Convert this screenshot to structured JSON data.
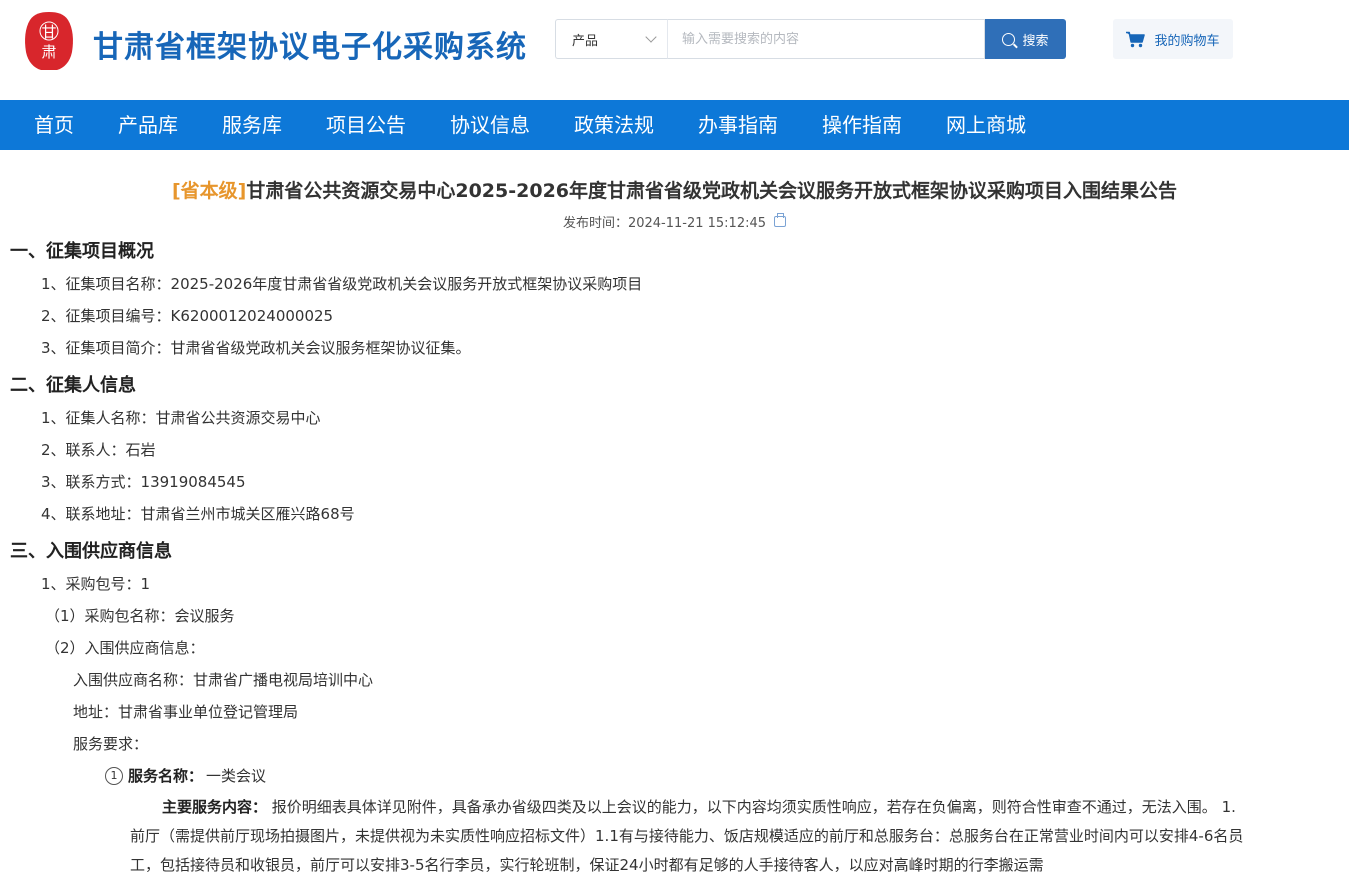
{
  "header": {
    "logo_text": "甘肃",
    "site_title": "甘肃省框架协议电子化采购系统",
    "search": {
      "category": "产品",
      "placeholder": "输入需要搜索的内容",
      "button_label": "搜索"
    },
    "cart_label": "我的购物车",
    "colors": {
      "title": "#1766b8",
      "nav": "#0d78d8",
      "logo": "#d8262c",
      "level_tag": "#e7962d"
    }
  },
  "nav": {
    "items": [
      "首页",
      "产品库",
      "服务库",
      "项目公告",
      "协议信息",
      "政策法规",
      "办事指南",
      "操作指南",
      "网上商城"
    ]
  },
  "article": {
    "level_tag": "[省本级]",
    "title": "甘肃省公共资源交易中心2025-2026年度甘肃省省级党政机关会议服务开放式框架协议采购项目入围结果公告",
    "publish_time": "发布时间：2024-11-21 15:12:45",
    "sections": {
      "s1": {
        "heading": "一、征集项目概况",
        "lines": [
          "1、征集项目名称：2025-2026年度甘肃省省级党政机关会议服务开放式框架协议采购项目",
          "2、征集项目编号：K6200012024000025",
          "3、征集项目简介：甘肃省省级党政机关会议服务框架协议征集。"
        ]
      },
      "s2": {
        "heading": "二、征集人信息",
        "lines": [
          "1、征集人名称：甘肃省公共资源交易中心",
          "2、联系人：石岩",
          "3、联系方式：13919084545",
          "4、联系地址：甘肃省兰州市城关区雁兴路68号"
        ]
      },
      "s3": {
        "heading": "三、入围供应商信息",
        "package_no": "1、采购包号：1",
        "package_name": "（1）采购包名称：会议服务",
        "supplier_info": "（2）入围供应商信息：",
        "supplier_name": "入围供应商名称：甘肃省广播电视局培训中心",
        "address": "地址：甘肃省事业单位登记管理局",
        "service_req": "服务要求：",
        "service_num": "1",
        "service_name_label": "服务名称：",
        "service_name_value": "一类会议",
        "main_content_label": "主要服务内容：",
        "main_content_text": "报价明细表具体详见附件，具备承办省级四类及以上会议的能力，以下内容均须实质性响应，若存在负偏离，则符合性审查不通过，无法入围。 1.前厅（需提供前厅现场拍摄图片，未提供视为未实质性响应招标文件）1.1有与接待能力、饭店规模适应的前厅和总服务台：总服务台在正常营业时间内可以安排4-6名员工，包括接待员和收银员，前厅可以安排3-5名行李员，实行轮班制，保证24小时都有足够的人手接待客人，以应对高峰时期的行李搬运需"
      }
    }
  }
}
